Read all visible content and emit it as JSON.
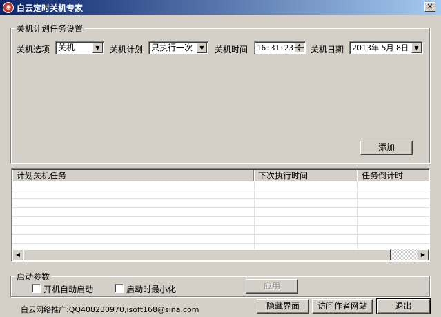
{
  "window": {
    "title": "白云定时关机专家",
    "icon": "app-logo-icon",
    "close_glyph": "✕"
  },
  "task_settings": {
    "group_label": "关机计划任务设置",
    "option_label": "关机选项",
    "option_value": "关机",
    "plan_label": "关机计划",
    "plan_value": "只执行一次",
    "time_label": "关机时间",
    "time_value": "16:31:23",
    "date_label": "关机日期",
    "date_value": "2013年 5月 8日",
    "add_button": "添加"
  },
  "task_list": {
    "columns": [
      "计划关机任务",
      "下次执行时间",
      "任务倒计时"
    ],
    "rows": []
  },
  "startup": {
    "group_label": "启动参数",
    "autostart_label": "开机自动启动",
    "autostart_checked": false,
    "minimize_label": "启动时最小化",
    "minimize_checked": false,
    "apply_button": "应用"
  },
  "footer": {
    "promo_text": "白云网络推广:QQ408230970,isoft168@sina.com",
    "hide_button": "隐藏界面",
    "visit_button": "访问作者网站",
    "exit_button": "退出"
  }
}
